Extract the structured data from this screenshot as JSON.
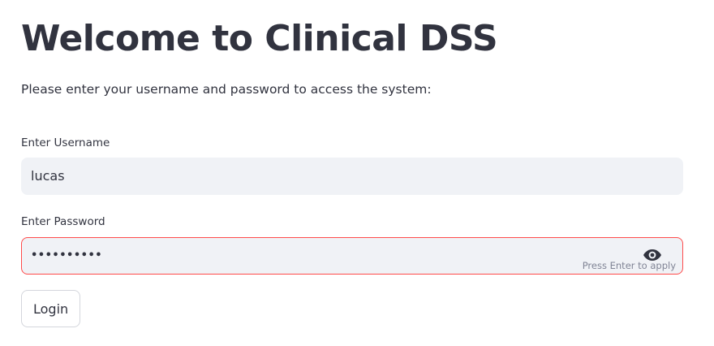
{
  "header": {
    "title": "Welcome to Clinical DSS"
  },
  "intro": {
    "text": "Please enter your username and password to access the system:"
  },
  "form": {
    "username": {
      "label": "Enter Username",
      "value": "lucas"
    },
    "password": {
      "label": "Enter Password",
      "masked_value": "••••••••••",
      "hint": "Press Enter to apply",
      "toggle_icon": "eye-icon"
    },
    "login_button_label": "Login"
  },
  "colors": {
    "text": "#31333f",
    "input_background": "#f0f2f6",
    "focus_border": "#ff4b4b",
    "hint_text": "#808495",
    "button_border": "#d4d6dc"
  }
}
